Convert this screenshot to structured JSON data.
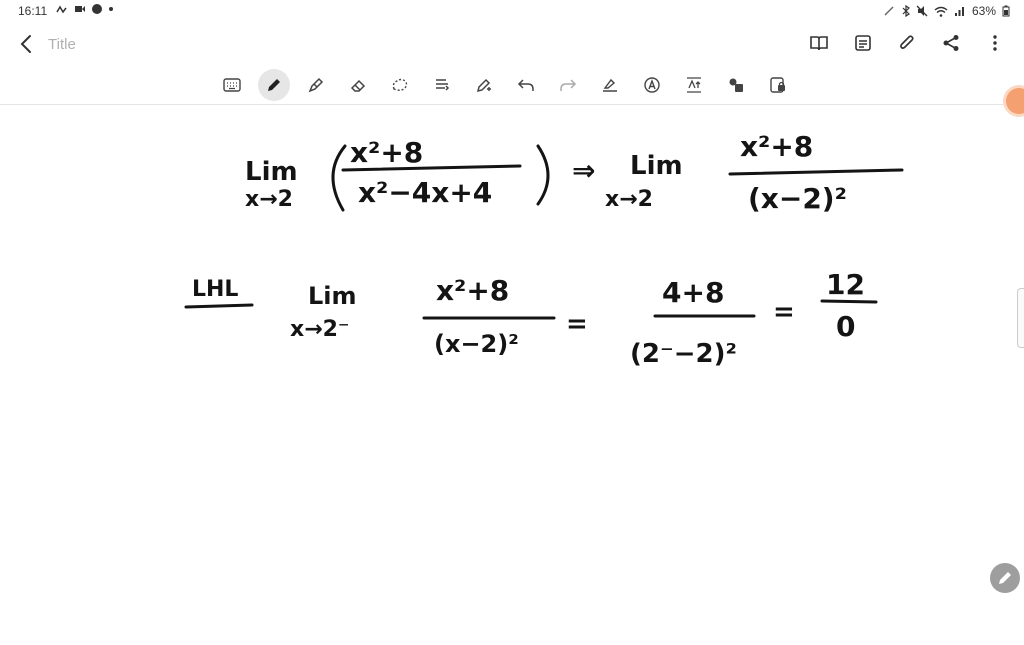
{
  "status": {
    "time": "16:11",
    "battery": "63%"
  },
  "header": {
    "title_placeholder": "Title"
  },
  "icons": {
    "back": "chevron-left-icon",
    "book": "book-icon",
    "page": "page-icon",
    "attach": "paperclip-icon",
    "share": "share-icon",
    "more": "more-vertical-icon"
  },
  "toolbar": {
    "active_tool": "pen"
  },
  "math": {
    "lim_label": "Lim",
    "x_to_2": "x→2",
    "x_to_2_minus": "x→2⁻",
    "line1_num": "x²+8",
    "line1_den": "x²−4x+4",
    "implies": "⇒",
    "line1_rhs_num": "x²+8",
    "line1_rhs_den": "(x−2)²",
    "lhl": "LHL",
    "line2_num": "x²+8",
    "line2_den": "(x−2)²",
    "equals": "=",
    "sub_num": "4+8",
    "sub_den": "(2⁻−2)²",
    "result_num": "12",
    "result_den": "0"
  }
}
